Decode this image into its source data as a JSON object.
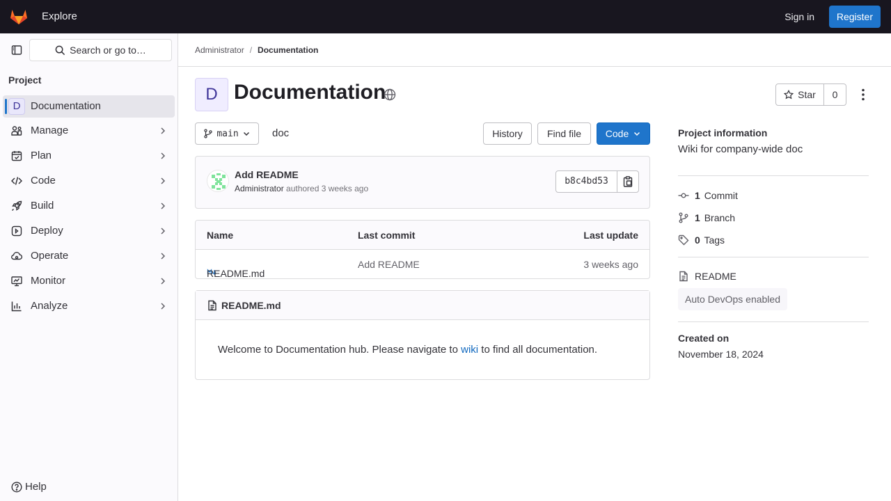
{
  "topbar": {
    "explore_label": "Explore",
    "signin_label": "Sign in",
    "register_label": "Register"
  },
  "sidebar": {
    "search_placeholder": "Search or go to…",
    "section_title": "Project",
    "project_item": {
      "initial": "D",
      "label": "Documentation"
    },
    "items": [
      {
        "label": "Manage",
        "icon": "users-icon"
      },
      {
        "label": "Plan",
        "icon": "calendar-icon"
      },
      {
        "label": "Code",
        "icon": "code-icon"
      },
      {
        "label": "Build",
        "icon": "rocket-icon"
      },
      {
        "label": "Deploy",
        "icon": "deploy-icon"
      },
      {
        "label": "Operate",
        "icon": "cloud-icon"
      },
      {
        "label": "Monitor",
        "icon": "monitor-icon"
      },
      {
        "label": "Analyze",
        "icon": "chart-icon"
      }
    ],
    "help_label": "Help"
  },
  "breadcrumb": {
    "parent": "Administrator",
    "current": "Documentation"
  },
  "project": {
    "initial": "D",
    "title": "Documentation",
    "star_label": "Star",
    "star_count": "0"
  },
  "repo": {
    "branch": "main",
    "path": "doc",
    "history_label": "History",
    "find_file_label": "Find file",
    "code_label": "Code"
  },
  "commit": {
    "title": "Add README",
    "author": "Administrator",
    "meta": "authored 3 weeks ago",
    "sha": "b8c4bd53"
  },
  "file_table": {
    "headers": [
      "Name",
      "Last commit",
      "Last update"
    ],
    "rows": [
      {
        "name": "README.md",
        "last_commit": "Add README",
        "last_update": "3 weeks ago"
      }
    ]
  },
  "readme": {
    "filename": "README.md",
    "text_before": "Welcome to Documentation hub. Please navigate to ",
    "link_text": "wiki",
    "text_after": " to find all documentation."
  },
  "project_info": {
    "title": "Project information",
    "description": "Wiki for company-wide doc",
    "commits_count": "1",
    "commits_label": "Commit",
    "branches_count": "1",
    "branches_label": "Branch",
    "tags_count": "0",
    "tags_label": "Tags",
    "readme_label": "README",
    "devops_badge": "Auto DevOps enabled",
    "created_label": "Created on",
    "created_date": "November 18, 2024"
  },
  "colors": {
    "topbar_bg": "#18161f",
    "accent": "#1f75cb",
    "link": "#1068bf",
    "sidebar_bg": "#fbfafd"
  }
}
